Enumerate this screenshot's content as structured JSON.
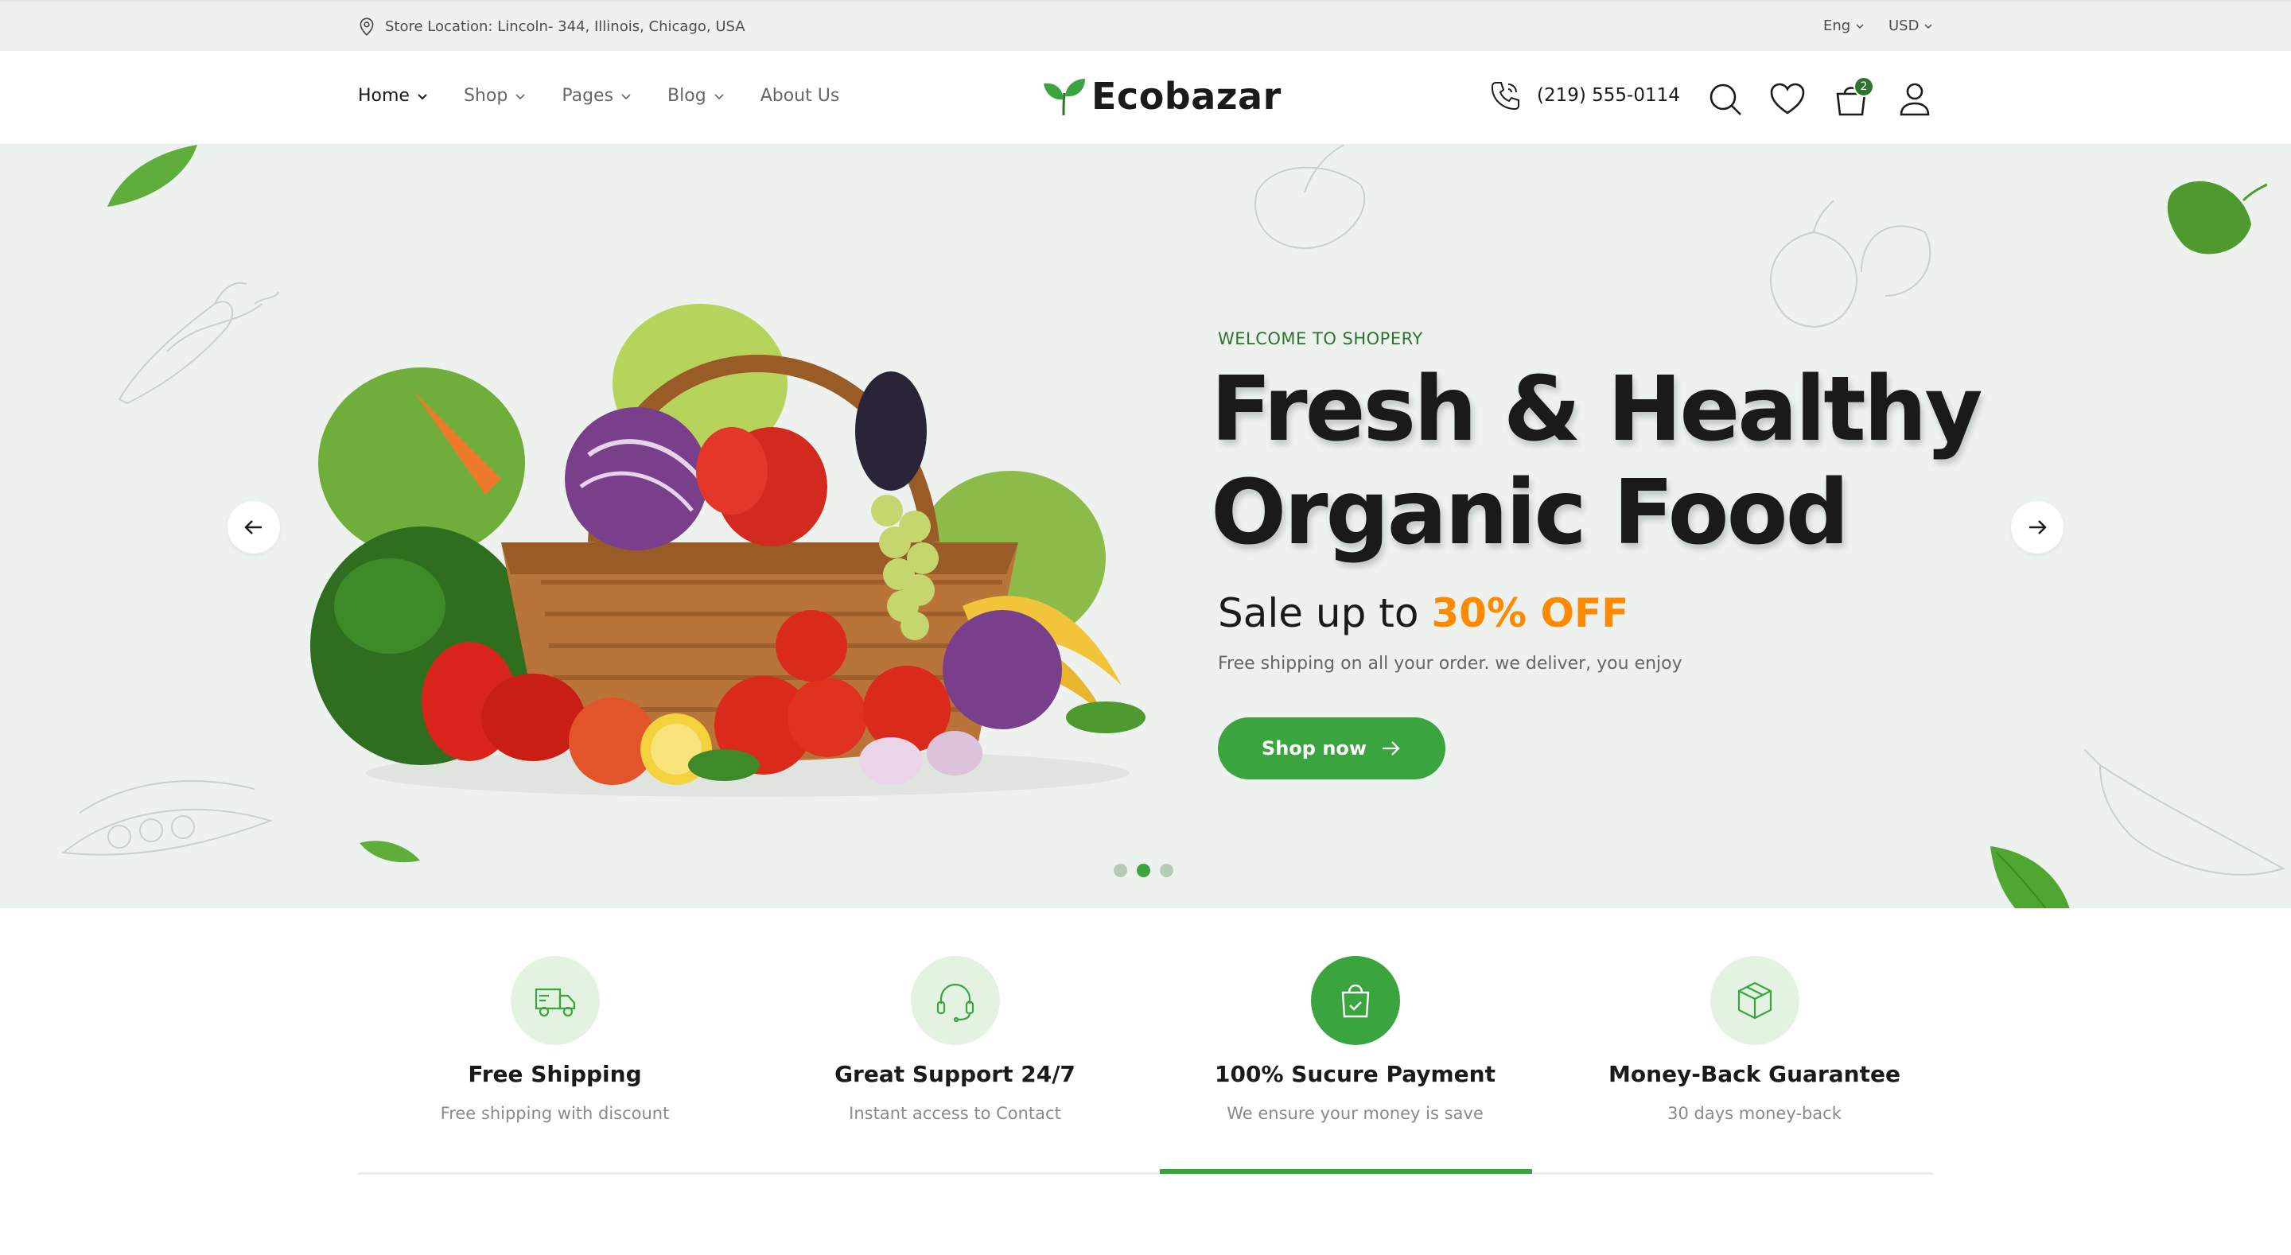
{
  "topbar": {
    "location": "Store Location: Lincoln- 344, Illinois, Chicago, USA",
    "language": "Eng",
    "currency": "USD"
  },
  "header": {
    "nav": [
      {
        "label": "Home"
      },
      {
        "label": "Shop"
      },
      {
        "label": "Pages"
      },
      {
        "label": "Blog"
      },
      {
        "label": "About Us"
      }
    ],
    "logo": "Ecobazar",
    "phone": "(219) 555-0114",
    "cart_count": "2"
  },
  "hero": {
    "welcome": "WELCOME TO SHOPERY",
    "headline_line1": "Fresh & Healthy",
    "headline_line2": "Organic Food",
    "sale_prefix": "Sale up to",
    "sale_highlight": "30% OFF",
    "note": "Free shipping on all your order. we deliver, you enjoy",
    "cta": "Shop now",
    "slide_count": 3,
    "active_slide": 2
  },
  "features": [
    {
      "title": "Free Shipping",
      "subtitle": "Free shipping with discount",
      "icon": "truck-icon"
    },
    {
      "title": "Great Support 24/7",
      "subtitle": "Instant access to Contact",
      "icon": "headset-icon"
    },
    {
      "title": "100% Sucure Payment",
      "subtitle": "We ensure your money is save",
      "icon": "shopping-bag-icon"
    },
    {
      "title": "Money-Back Guarantee",
      "subtitle": "30 days money-back",
      "icon": "package-icon"
    }
  ],
  "colors": {
    "primary_green": "#3aa43e",
    "dark_green": "#2c742f",
    "accent_orange": "#ff8a00",
    "hero_bg": "#edf2ee",
    "topbar_bg": "#eef1ee"
  }
}
